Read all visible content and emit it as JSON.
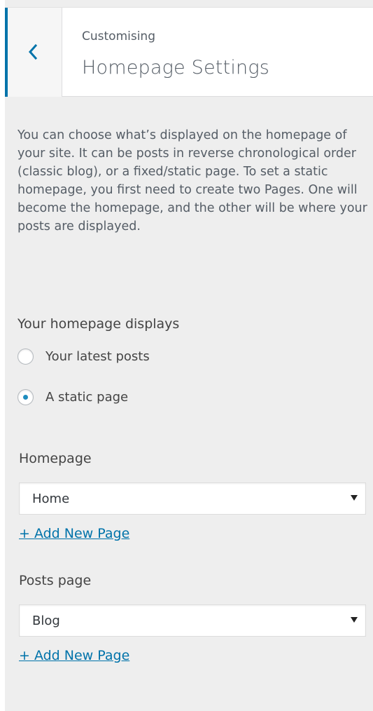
{
  "header": {
    "back_icon": "chevron-left-icon",
    "breadcrumb": "Customising",
    "title": "Homepage Settings"
  },
  "description": "You can choose what’s displayed on the homepage of your site. It can be posts in reverse chronological order (classic blog), or a fixed/static page. To set a static homepage, you first need to create two Pages. One will become the homepage, and the other will be where your posts are displayed.",
  "homepage_displays": {
    "title": "Your homepage displays",
    "options": [
      {
        "label": "Your latest posts",
        "checked": false
      },
      {
        "label": "A static page",
        "checked": true
      }
    ]
  },
  "homepage": {
    "label": "Homepage",
    "selected": "Home",
    "add_link": "+ Add New Page"
  },
  "posts_page": {
    "label": "Posts page",
    "selected": "Blog",
    "add_link": "+ Add New Page"
  },
  "colors": {
    "accent": "#0073aa",
    "panel_background": "#eeeeee",
    "radio_checked": "#1e8cbe"
  }
}
